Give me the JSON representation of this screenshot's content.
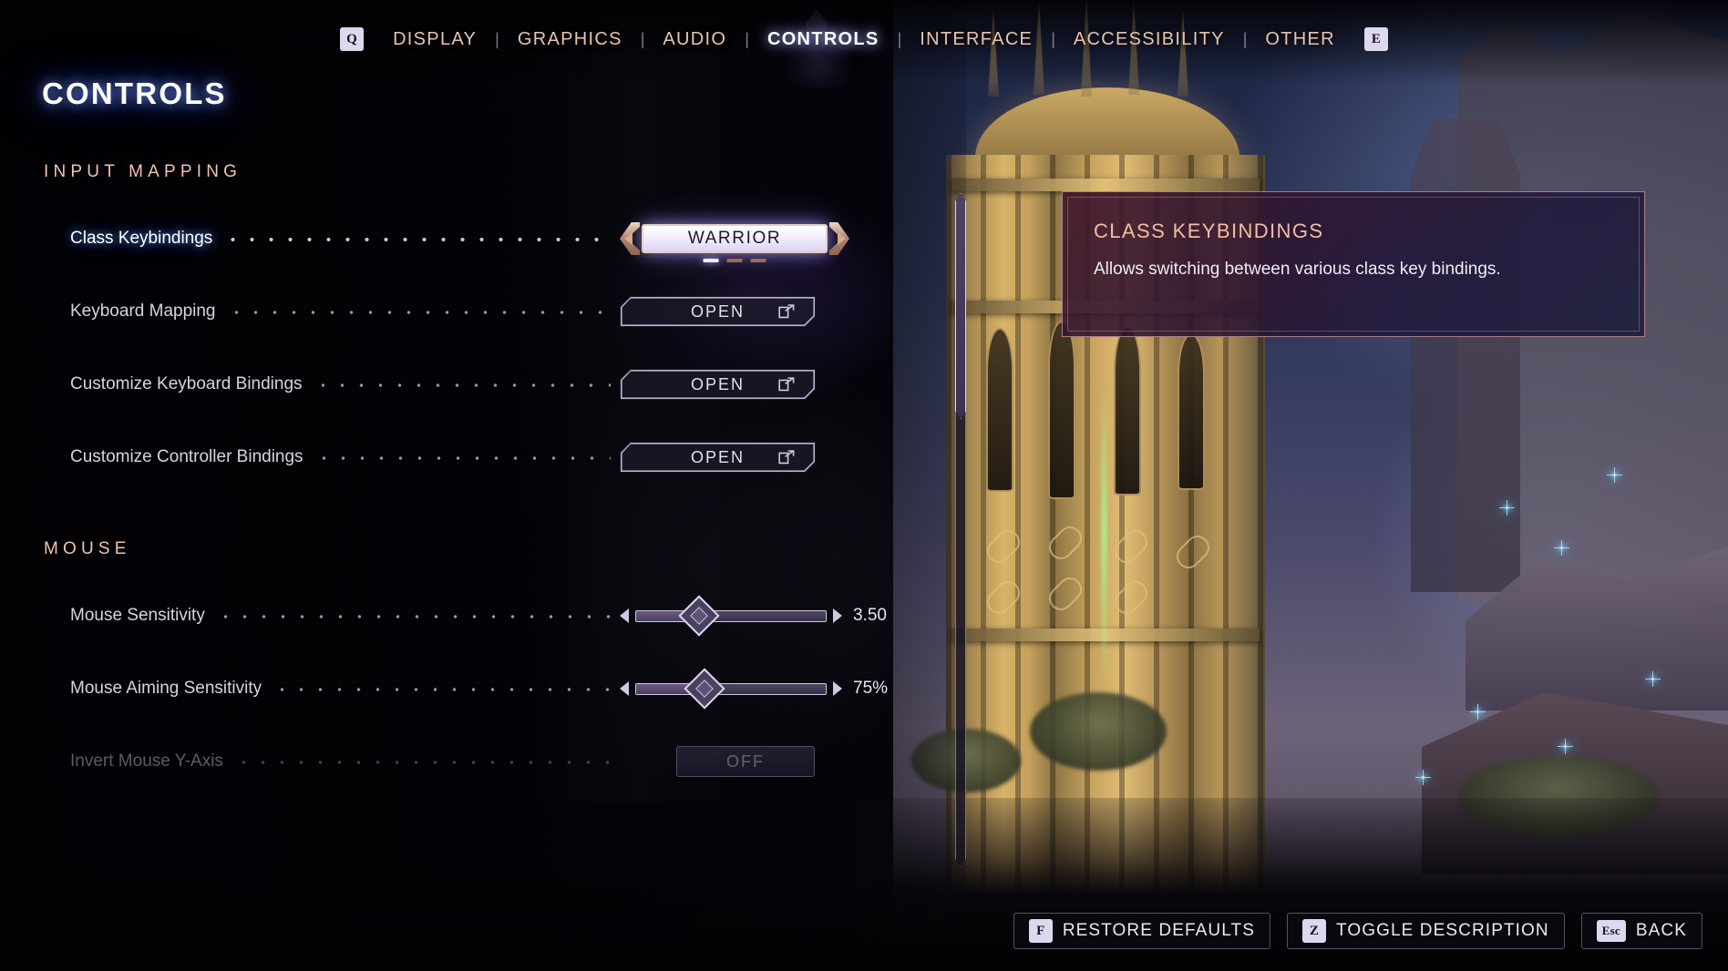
{
  "nav": {
    "left_key": "Q",
    "right_key": "E",
    "separator": "|",
    "items": [
      {
        "label": "DISPLAY",
        "active": false
      },
      {
        "label": "GRAPHICS",
        "active": false
      },
      {
        "label": "AUDIO",
        "active": false
      },
      {
        "label": "CONTROLS",
        "active": true
      },
      {
        "label": "INTERFACE",
        "active": false
      },
      {
        "label": "ACCESSIBILITY",
        "active": false
      },
      {
        "label": "OTHER",
        "active": false
      }
    ]
  },
  "page": {
    "title": "CONTROLS"
  },
  "sections": [
    {
      "header": "INPUT MAPPING",
      "rows": [
        {
          "label": "Class Keybindings",
          "control": "stepper",
          "value": "WARRIOR",
          "selected": true,
          "page_index": 1,
          "page_count": 3
        },
        {
          "label": "Keyboard Mapping",
          "control": "open",
          "value": "OPEN",
          "selected": false
        },
        {
          "label": "Customize Keyboard Bindings",
          "control": "open",
          "value": "OPEN",
          "selected": false
        },
        {
          "label": "Customize Controller Bindings",
          "control": "open",
          "value": "OPEN",
          "selected": false
        }
      ]
    },
    {
      "header": "MOUSE",
      "rows": [
        {
          "label": "Mouse Sensitivity",
          "control": "slider",
          "value": "3.50",
          "percent": 33,
          "selected": false
        },
        {
          "label": "Mouse Aiming Sensitivity",
          "control": "slider",
          "value": "75%",
          "percent": 36,
          "selected": false
        },
        {
          "label": "Invert Mouse Y-Axis",
          "control": "toggle",
          "value": "OFF",
          "selected": false,
          "faded": true
        }
      ]
    }
  ],
  "tooltip": {
    "title": "CLASS KEYBINDINGS",
    "body": "Allows switching between various class key bindings."
  },
  "bottom_bar": [
    {
      "key": "F",
      "label": "RESTORE DEFAULTS"
    },
    {
      "key": "Z",
      "label": "TOGGLE DESCRIPTION"
    },
    {
      "key": "Esc",
      "label": "BACK"
    }
  ],
  "colors": {
    "accent_peach": "#f0c4b0",
    "selected_glow": "#7aa0ff",
    "text_primary": "#ece8f4",
    "keycap_bg": "#ded8ef"
  }
}
